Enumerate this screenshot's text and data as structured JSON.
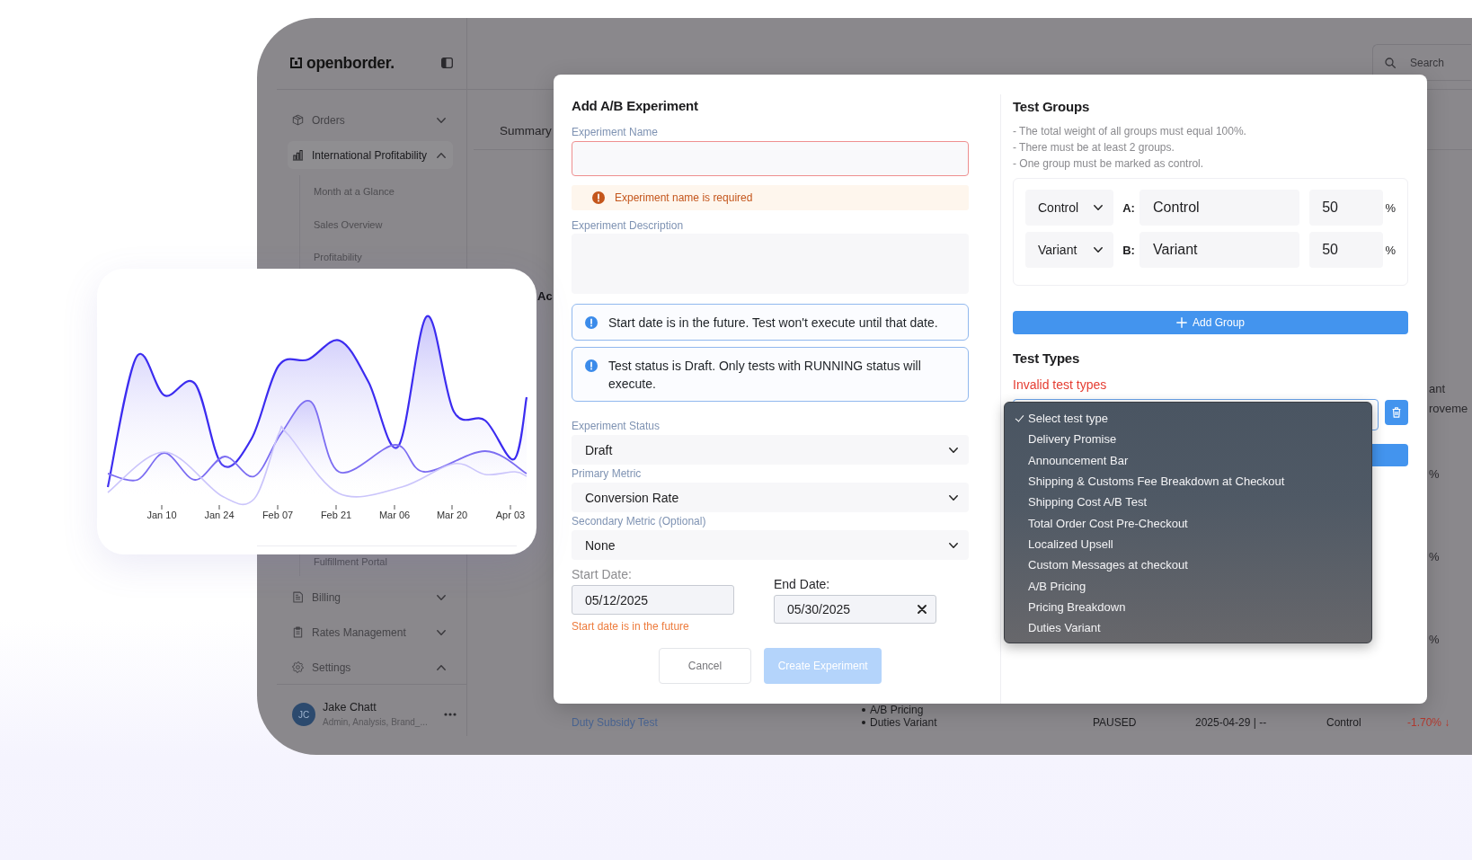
{
  "sidebar": {
    "logo": "openborder.",
    "items": [
      {
        "label": "Orders",
        "expanded": false,
        "selected": false
      },
      {
        "label": "International Profitability",
        "expanded": true,
        "selected": true,
        "children": [
          {
            "label": "Month at a Glance",
            "selected": false
          },
          {
            "label": "Sales Overview",
            "selected": false
          },
          {
            "label": "Profitability",
            "selected": false
          },
          {
            "label": "Fulfillment Portal",
            "selected": false
          }
        ]
      },
      {
        "label": "Billing",
        "expanded": false,
        "selected": false
      },
      {
        "label": "Rates Management",
        "expanded": false,
        "selected": false
      },
      {
        "label": "Settings",
        "expanded": true,
        "selected": false
      }
    ],
    "user": {
      "initials": "JC",
      "name": "Jake Chatt",
      "roles": "Admin, Analysis, Brand_..."
    }
  },
  "header": {
    "search": {
      "placeholder": "Search"
    }
  },
  "tabs": [
    {
      "label": "Summary",
      "selected": true
    }
  ],
  "content": {
    "heading": "Ac",
    "column_fragments": [
      "ant",
      "roveme"
    ],
    "percent_marks": [
      "%",
      "%",
      "%"
    ],
    "row": {
      "column_1": "Duty Subsidy Test",
      "column_2": [
        "A/B Pricing",
        "Duties Variant"
      ],
      "column_3": "PAUSED",
      "column_4": "2025-04-29 | --",
      "column_5": "Control",
      "column_6": "-1.70% ↓"
    }
  },
  "modal": {
    "title": "Add A/B Experiment",
    "name_field": {
      "label": "Experiment Name",
      "invalid": true,
      "error": "Experiment name is required"
    },
    "description_field": {
      "label": "Experiment Description"
    },
    "alerts": [
      {
        "text": "Start date is in the future. Test won't execute until that date."
      },
      {
        "text": "Test status is Draft. Only tests with RUNNING status will execute."
      }
    ],
    "selects": [
      {
        "label": "Experiment Status",
        "value": "Draft"
      },
      {
        "label": "Primary Metric",
        "value": "Conversion Rate"
      },
      {
        "label": "Secondary Metric (Optional)",
        "value": "None"
      }
    ],
    "start_date": {
      "label": "Start Date:",
      "value": "05/12/2025",
      "error": "Start date is in the future"
    },
    "end_date": {
      "label": "End Date:",
      "value": "05/30/2025",
      "clearable": true
    },
    "buttons": [
      {
        "label": "Cancel",
        "kind": "secondary",
        "disabled": false
      },
      {
        "label": "Create Experiment",
        "kind": "primary",
        "disabled": true
      }
    ],
    "test_groups": {
      "title": "Test Groups",
      "rules": [
        "- The total weight of all groups must equal 100%.",
        "- There must be at least 2 groups.",
        "- One group must be marked as control."
      ],
      "groups": [
        {
          "role": "Control",
          "letter": "A:",
          "name": "Control",
          "weight": "50",
          "unit": "%"
        },
        {
          "role": "Variant",
          "letter": "B:",
          "name": "Variant",
          "weight": "50",
          "unit": "%"
        }
      ],
      "add_button": "Add Group"
    },
    "test_types": {
      "title": "Test Types",
      "error": "Invalid test types",
      "dropdown": {
        "open": true,
        "options": [
          {
            "label": "Select test type",
            "selected": true
          },
          {
            "label": "Delivery Promise",
            "selected": false
          },
          {
            "label": "Announcement Bar",
            "selected": false
          },
          {
            "label": "Shipping & Customs Fee Breakdown at Checkout",
            "selected": false
          },
          {
            "label": "Shipping Cost A/B Test",
            "selected": false
          },
          {
            "label": "Total Order Cost Pre-Checkout",
            "selected": false
          },
          {
            "label": "Localized Upsell",
            "selected": false
          },
          {
            "label": "Custom Messages at checkout",
            "selected": false
          },
          {
            "label": "A/B Pricing",
            "selected": false
          },
          {
            "label": "Pricing Breakdown",
            "selected": false
          },
          {
            "label": "Duties Variant",
            "selected": false
          }
        ]
      }
    }
  },
  "chart_card": {
    "axis_labels": [
      "Jan 10",
      "Jan 24",
      "Feb 07",
      "Feb 21",
      "Mar 06",
      "Mar 20",
      "Apr 03"
    ]
  }
}
